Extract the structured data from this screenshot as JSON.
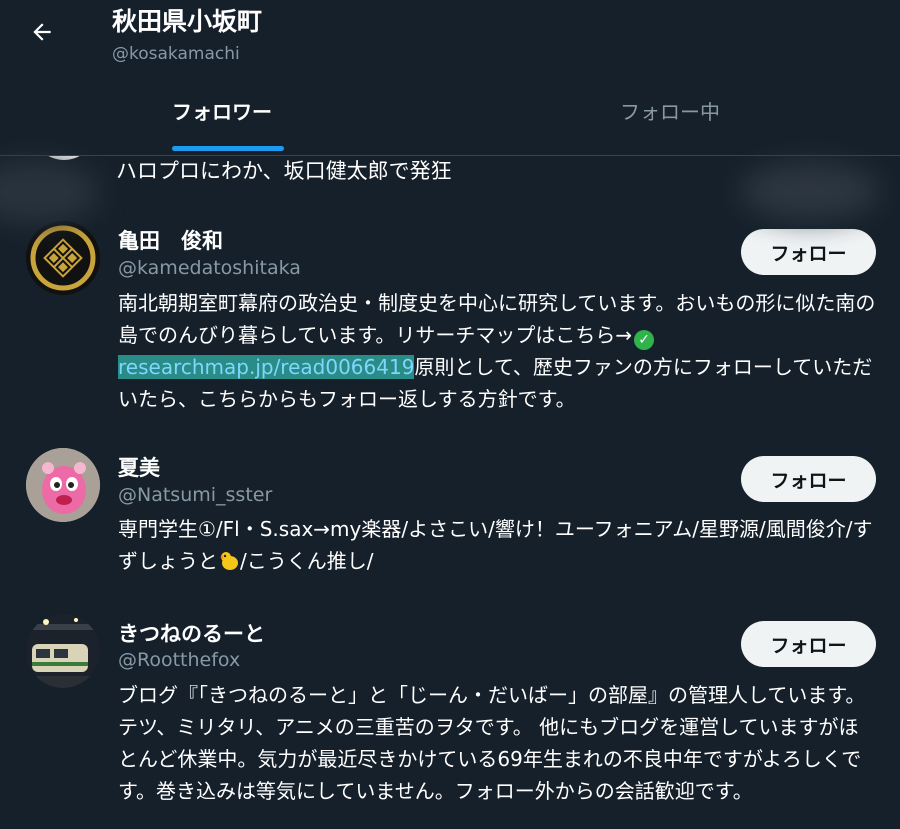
{
  "header": {
    "title": "秋田県小坂町",
    "handle": "@kosakamachi",
    "tabs": [
      {
        "label": "フォロワー",
        "active": true
      },
      {
        "label": "フォロー中",
        "active": false
      }
    ],
    "accent": "#1d9bf0"
  },
  "partial_user": {
    "bio": "ハロプロにわか、坂口健太郎で発狂"
  },
  "users": [
    {
      "name": "亀田　俊和",
      "handle": "@kamedatoshitaka",
      "follow_label": "フォロー",
      "bio_part1": "南北朝期室町幕府の政治史・制度史を中心に研究しています。おいもの形に似た南の島でのんびり暮らしています。リサーチマップはこちら→",
      "bio_link": "researchmap.jp/read0066419",
      "bio_part2": "原則として、歴史ファンの方にフォローしていただいたら、こちらからもフォロー返しする方針です。",
      "avatar_icon": "family-crest-icon"
    },
    {
      "name": "夏美",
      "handle": "@Natsumi_sster",
      "follow_label": "フォロー",
      "bio_part1": "専門学生①/Fl・S.sax→my楽器/よさこい/響け！ユーフォニアム/星野源/風間俊介/すずしょうと",
      "bio_part2": "/こうくん推し/",
      "avatar_icon": "pink-mascot-icon"
    },
    {
      "name": "きつねのるーと",
      "handle": "@Rootthefox",
      "follow_label": "フォロー",
      "bio": "ブログ『「きつねのるーと」と「じーん・だいばー」の部屋』の管理人しています。テツ、ミリタリ、アニメの三重苦のヲタです。 他にもブログを運営していますがほとんど休業中。気力が最近尽きかけている69年生まれの不良中年ですがよろしくです。巻き込みは等気にしていません。フォロー外からの会話歓迎です。",
      "avatar_icon": "train-photo-icon"
    }
  ]
}
